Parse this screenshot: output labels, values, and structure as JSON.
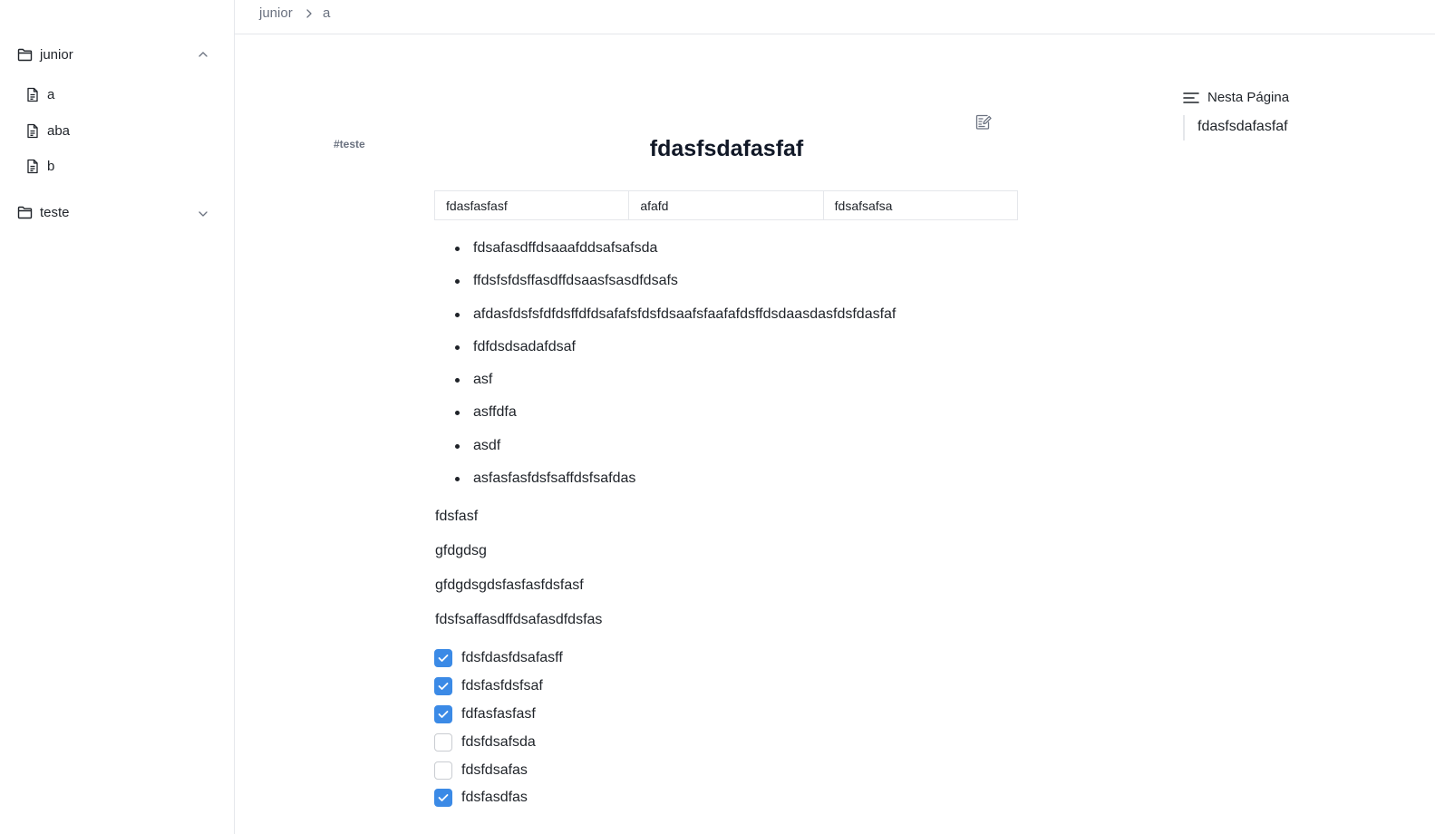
{
  "sidebar": {
    "folders": [
      {
        "label": "junior",
        "expanded": true,
        "icon": "folder-icon",
        "chevron": "chevron-up-icon",
        "pages": [
          {
            "label": "a"
          },
          {
            "label": "aba"
          },
          {
            "label": "b"
          }
        ]
      },
      {
        "label": "teste",
        "expanded": false,
        "icon": "folder-icon",
        "chevron": "chevron-down-icon",
        "pages": []
      }
    ]
  },
  "breadcrumb": {
    "items": [
      "junior",
      "a"
    ]
  },
  "doc": {
    "tag": "#teste",
    "title": "fdasfsdafasfaf",
    "table": [
      "fdasfasfasf",
      "afafd",
      "fdsafsafsa"
    ],
    "bullets": [
      "fdsafasdffdsaaafddsafsafsda",
      "ffdsfsfdsffasdffdsaasfsasdfdsafs",
      "afdasfdsfsfdfdsffdfdsafafsfdsfdsaafsfaafafdsffdsdaasdasfdsfdasfaf",
      "fdfdsdsadafdsaf",
      "asf",
      "asffdfa",
      "asdf",
      "asfasfasfdsfsaffdsfsafdas"
    ],
    "paragraphs": [
      "fdsfasf",
      "gfdgdsg",
      "gfdgdsgdsfasfasfdsfasf",
      "fdsfsaffasdffdsafasdfdsfas"
    ],
    "tasks": [
      {
        "label": "fdsfdasfdsafasff",
        "checked": true
      },
      {
        "label": "fdsfasfdsfsaf",
        "checked": true
      },
      {
        "label": "fdfasfasfasf",
        "checked": true
      },
      {
        "label": "fdsfdsafsda",
        "checked": false
      },
      {
        "label": "fdsfdsafas",
        "checked": false
      },
      {
        "label": "fdsfasdfas",
        "checked": true
      }
    ]
  },
  "toc": {
    "heading": "Nesta Página",
    "items": [
      "fdasfsdafasfaf"
    ]
  },
  "colors": {
    "accent": "#3b8ae6",
    "border": "#e5e7eb",
    "text": "#1f2329",
    "muted": "#6b7280"
  }
}
